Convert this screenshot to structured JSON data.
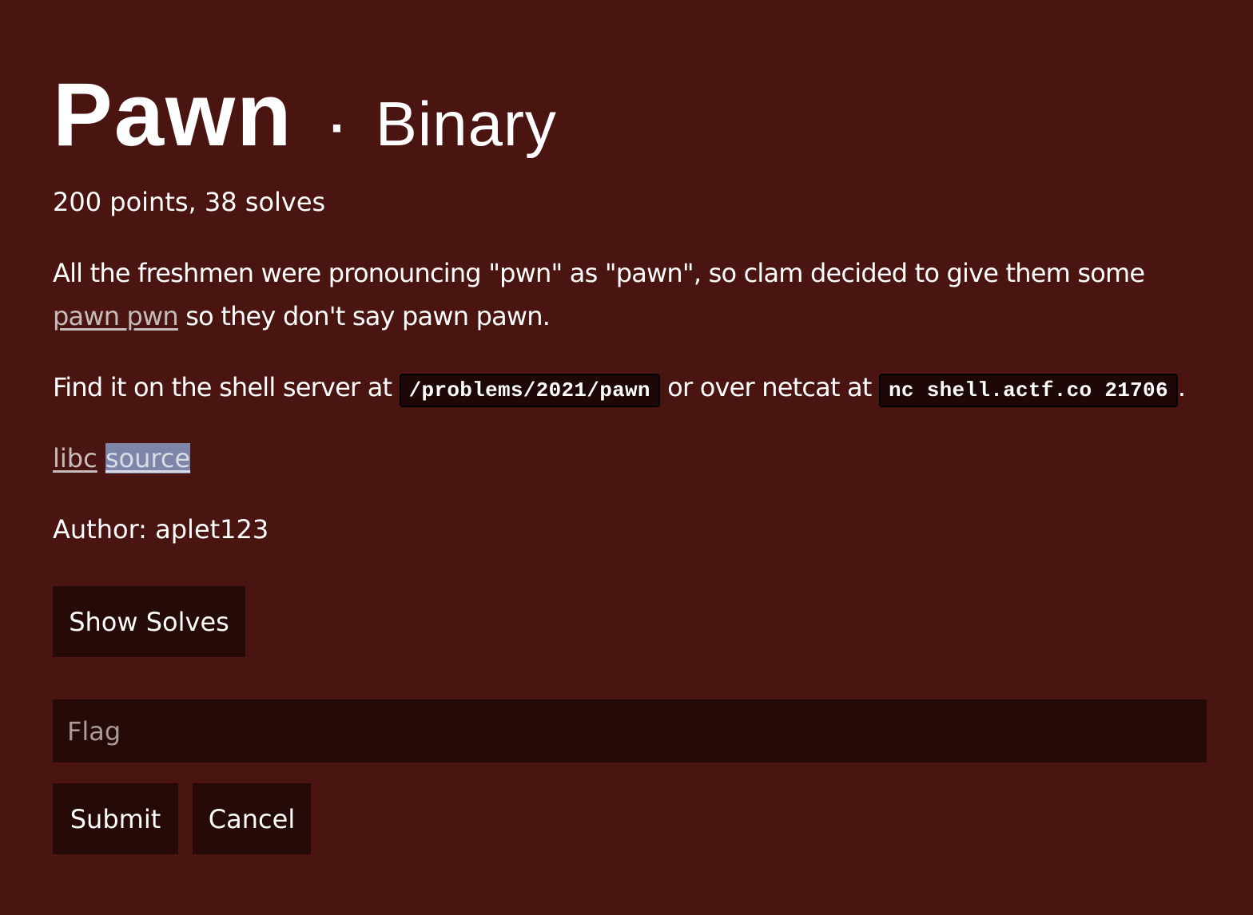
{
  "challenge": {
    "name": "Pawn",
    "separator": "·",
    "category": "Binary",
    "stats": "200 points, 38 solves",
    "description": {
      "before_link": "All the freshmen were pronouncing \"pwn\" as \"pawn\", so clam decided to give them some ",
      "link_text": "pawn pwn",
      "after_link": " so they don't say pawn pawn."
    },
    "location": {
      "prefix": "Find it on the shell server at ",
      "path": "/problems/2021/pawn",
      "middle": " or over netcat at ",
      "netcat": "nc shell.actf.co 21706",
      "suffix": "."
    },
    "files": [
      {
        "label": "libc"
      },
      {
        "label": "source"
      }
    ],
    "author": "Author: aplet123"
  },
  "actions": {
    "show_solves_label": "Show Solves",
    "flag_placeholder": "Flag",
    "submit_label": "Submit",
    "cancel_label": "Cancel"
  },
  "colors": {
    "background": "#4a1511",
    "button": "#260a08",
    "link": "#c6bcbb",
    "selection": "#7d86a8"
  }
}
